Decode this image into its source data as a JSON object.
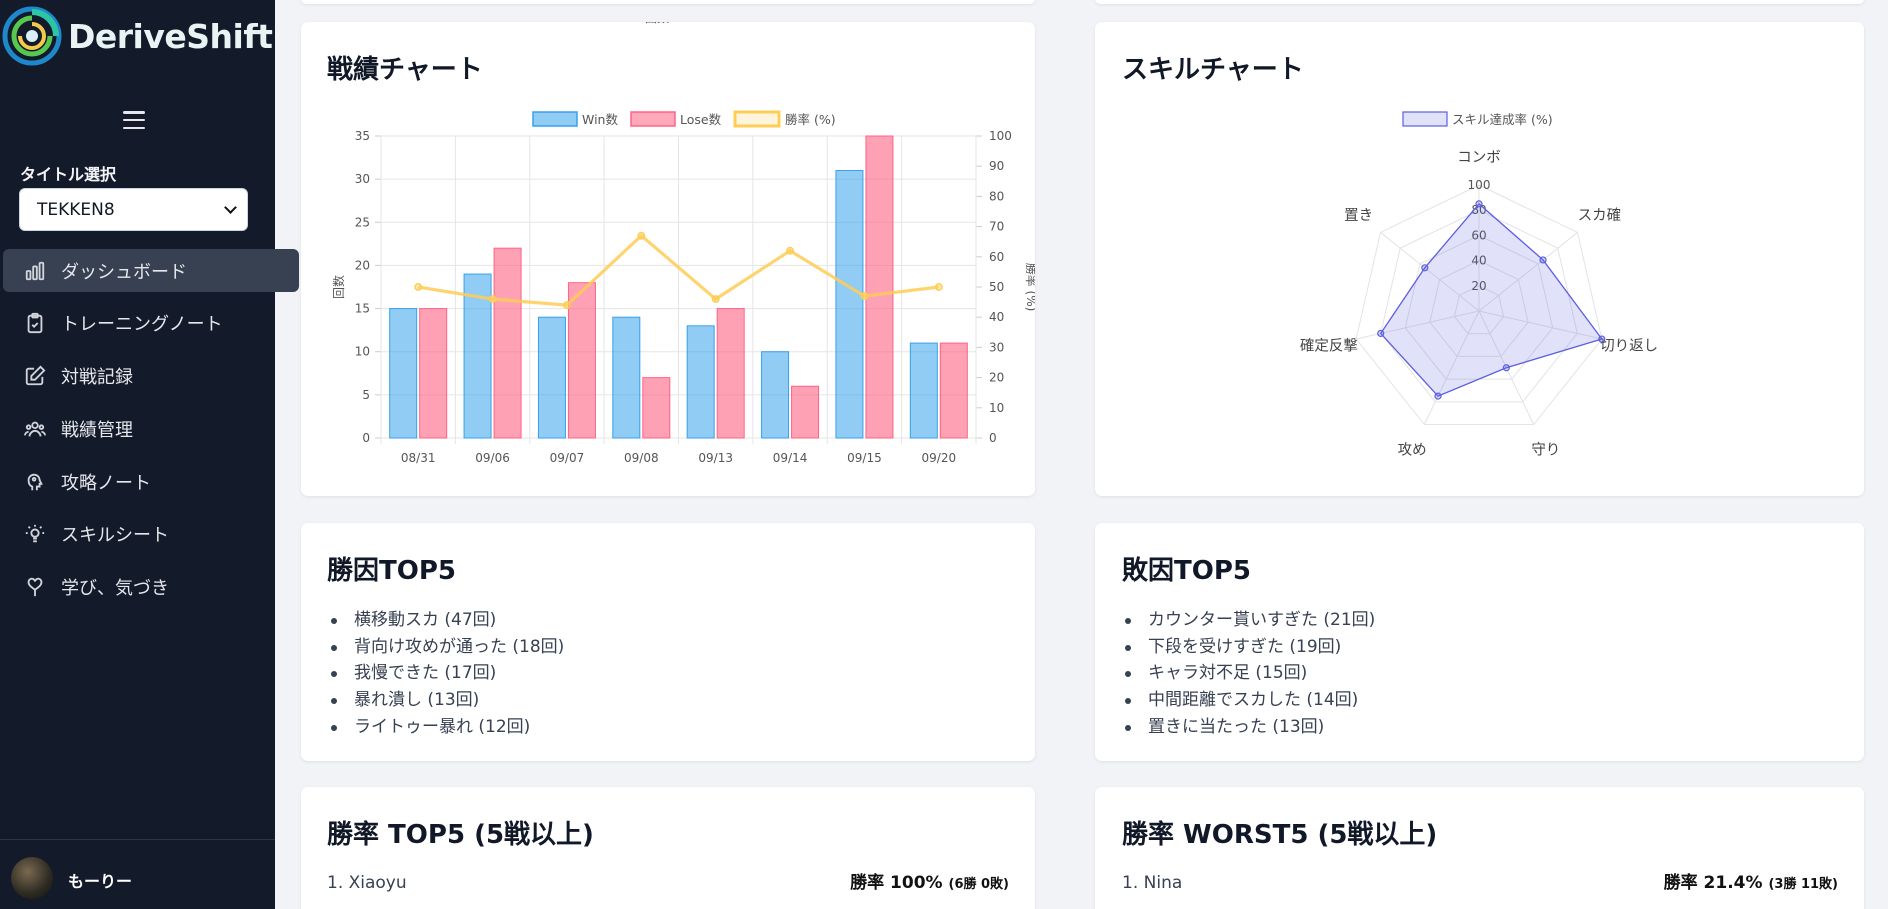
{
  "app": {
    "name": "DeriveShift"
  },
  "sidebar": {
    "title_select_label": "タイトル選択",
    "title_select_value": "TEKKEN8",
    "items": [
      {
        "label": "ダッシュボード",
        "icon": "bar-chart-icon",
        "active": true
      },
      {
        "label": "トレーニングノート",
        "icon": "clipboard-check-icon",
        "active": false
      },
      {
        "label": "対戦記録",
        "icon": "edit-icon",
        "active": false
      },
      {
        "label": "戦績管理",
        "icon": "users-icon",
        "active": false
      },
      {
        "label": "攻略ノート",
        "icon": "head-icon",
        "active": false
      },
      {
        "label": "スキルシート",
        "icon": "lightbulb-icon",
        "active": false
      },
      {
        "label": "学び、気づき",
        "icon": "heart-pin-icon",
        "active": false
      }
    ],
    "user": {
      "name": "もーりー"
    }
  },
  "record_chart": {
    "title": "戦績チャート",
    "legend": {
      "win": "Win数",
      "lose": "Lose数",
      "rate": "勝率 (%)"
    },
    "colors": {
      "win": "#36a2eb",
      "lose": "#ff6384",
      "rate": "#ffcd56"
    }
  },
  "skill_chart": {
    "title": "スキルチャート",
    "legend": "スキル達成率 (%)",
    "color": "#5b5fe0"
  },
  "chart_data": [
    {
      "type": "bar",
      "title": "",
      "categories": [
        "08/31",
        "09/06",
        "09/07",
        "09/08",
        "09/13",
        "09/14",
        "09/15",
        "09/20"
      ],
      "series": [
        {
          "name": "Win数",
          "axis": "left",
          "values": [
            15,
            19,
            14,
            14,
            13,
            10,
            31,
            11
          ]
        },
        {
          "name": "Lose数",
          "axis": "left",
          "values": [
            15,
            22,
            18,
            7,
            15,
            6,
            35,
            11
          ]
        },
        {
          "name": "勝率 (%)",
          "axis": "right",
          "type": "line",
          "values": [
            50,
            46,
            44,
            67,
            46,
            62,
            47,
            50
          ]
        }
      ],
      "ylabel": "回数",
      "ylabel_right": "勝率 (%)",
      "ylim": [
        0,
        35
      ],
      "ylim_right": [
        0,
        100
      ],
      "yticks": [
        0,
        5,
        10,
        15,
        20,
        25,
        30,
        35
      ],
      "yticks_right": [
        0,
        10,
        20,
        30,
        40,
        50,
        60,
        70,
        80,
        90,
        100
      ],
      "grid": true,
      "legend": "top"
    },
    {
      "type": "radar",
      "title": "",
      "categories": [
        "コンボ",
        "スカ確",
        "切り返し",
        "守り",
        "攻め",
        "確定反撃",
        "置き"
      ],
      "series": [
        {
          "name": "スキル達成率 (%)",
          "values": [
            85,
            65,
            100,
            50,
            75,
            80,
            55
          ]
        }
      ],
      "rlim": [
        0,
        100
      ],
      "rticks": [
        20,
        40,
        60,
        80,
        100
      ],
      "legend": "top"
    }
  ],
  "win_factors": {
    "title": "勝因TOP5",
    "items": [
      "横移動スカ (47回)",
      "背向け攻めが通った (18回)",
      "我慢できた (17回)",
      "暴れ潰し (13回)",
      "ライトゥー暴れ (12回)"
    ]
  },
  "lose_factors": {
    "title": "敗因TOP5",
    "items": [
      "カウンター貰いすぎた (21回)",
      "下段を受けすぎた (19回)",
      "キャラ対不足 (15回)",
      "中間距離でスカした (14回)",
      "置きに当たった (13回)"
    ]
  },
  "winrate_top": {
    "title": "勝率 TOP5 (5戦以上)",
    "rows": [
      {
        "name": "1. Xiaoyu",
        "rate": "勝率 100%",
        "detail": "(6勝 0敗)"
      }
    ]
  },
  "winrate_worst": {
    "title": "勝率 WORST5 (5戦以上)",
    "rows": [
      {
        "name": "1. Nina",
        "rate": "勝率 21.4%",
        "detail": "(3勝 11敗)"
      }
    ]
  }
}
